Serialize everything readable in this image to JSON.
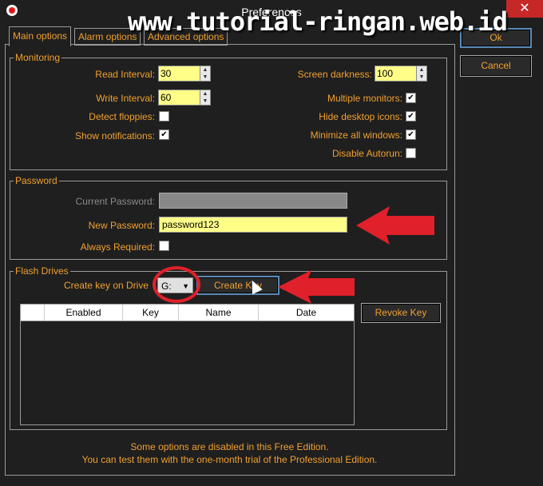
{
  "window": {
    "title": "Preferences",
    "close": "✕"
  },
  "watermark": "www.tutorial-ringan.web.id",
  "tabs": [
    {
      "label": "Main options"
    },
    {
      "label": "Alarm options"
    },
    {
      "label": "Advanced options"
    }
  ],
  "buttons": {
    "ok": "Ok",
    "cancel": "Cancel"
  },
  "monitoring": {
    "legend": "Monitoring",
    "read_interval_label": "Read Interval:",
    "read_interval_value": "30",
    "write_interval_label": "Write Interval:",
    "write_interval_value": "60",
    "detect_floppies_label": "Detect floppies:",
    "detect_floppies_checked": "",
    "show_notifications_label": "Show notifications:",
    "show_notifications_checked": "✔",
    "screen_darkness_label": "Screen darkness:",
    "screen_darkness_value": "100",
    "multiple_monitors_label": "Multiple monitors:",
    "multiple_monitors_checked": "✔",
    "hide_desktop_icons_label": "Hide desktop icons:",
    "hide_desktop_icons_checked": "✔",
    "minimize_all_windows_label": "Minimize all windows:",
    "minimize_all_windows_checked": "✔",
    "disable_autorun_label": "Disable Autorun:",
    "disable_autorun_checked": ""
  },
  "password": {
    "legend": "Password",
    "current_label": "Current Password:",
    "current_value": "",
    "new_label": "New Password:",
    "new_value": "password123",
    "always_required_label": "Always Required:",
    "always_required_checked": ""
  },
  "flash": {
    "legend": "Flash Drives",
    "create_key_label": "Create key on Drive",
    "drive_value": "G:",
    "create_key_button": "Create Key",
    "revoke_key_button": "Revoke Key",
    "columns": [
      "",
      "Enabled",
      "Key",
      "Name",
      "Date"
    ]
  },
  "footer": {
    "line1": "Some options are disabled in this Free Edition.",
    "line2": "You can test them with the one-month trial of the Professional Edition."
  },
  "colors": {
    "accent": "#f0a030",
    "background": "#1f1f1f",
    "input_yellow": "#ffff88",
    "annotation_red": "#e0202a"
  }
}
